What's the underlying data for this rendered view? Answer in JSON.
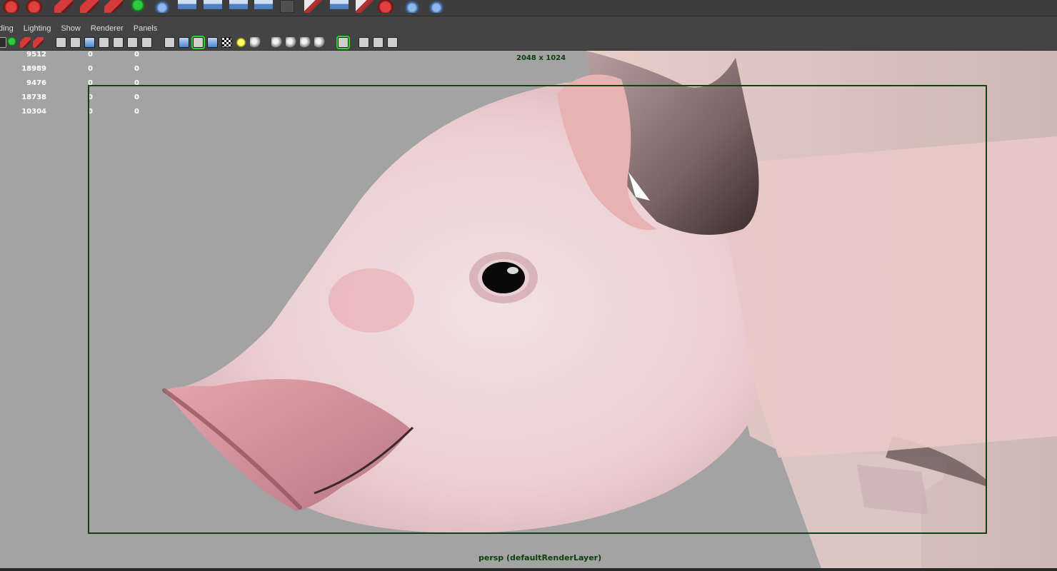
{
  "shelf": {
    "icons": [
      "red-curve-icon",
      "red-paint-icon",
      "red-stroke-icon",
      "red-brush-icon",
      "red-arrow-icon",
      "green-vertex-icon",
      "sphere-cut-icon",
      "cluster-icon",
      "cluster-icon-2",
      "cluster-icon-3",
      "cluster-icon-4",
      "node-graph-icon",
      "cube-copy-icon",
      "cube-copy-icon-2",
      "cube-copy-icon-3",
      "no-render-icon",
      "joint-tool-icon",
      "ik-tool-icon"
    ]
  },
  "panel_menu": {
    "items": [
      "ding",
      "Lighting",
      "Show",
      "Renderer",
      "Panels"
    ]
  },
  "panel_toolbar": {
    "icons": [
      "camera-attribute-icon",
      "image-plane-icon",
      "bookmark-icon",
      "grid-icon",
      "film-gate-icon",
      "resolution-gate-icon",
      "gate-mask-icon",
      "field-chart-icon",
      "safe-action-icon",
      "safe-title-icon",
      "wireframe-icon",
      "smooth-shade-icon",
      "wireframe-on-shaded-icon",
      "flat-shade-icon",
      "bounding-box-icon",
      "textured-icon",
      "use-all-lights-icon",
      "shadows-icon",
      "ambient-occlusion-icon",
      "motion-blur-icon",
      "anti-aliasing-icon",
      "depth-of-field-icon",
      "isolate-select-icon",
      "xray-icon",
      "xray-joints-icon",
      "xray-components-icon"
    ]
  },
  "hud": {
    "rows": [
      [
        "9512",
        "0",
        "0"
      ],
      [
        "18989",
        "0",
        "0"
      ],
      [
        "9476",
        "0",
        "0"
      ],
      [
        "18738",
        "0",
        "0"
      ],
      [
        "10304",
        "0",
        "0"
      ]
    ]
  },
  "viewport": {
    "resolution_label": "2048 x 1024",
    "camera_label": "persp (defaultRenderLayer)",
    "gate_color": "#124212",
    "background_color": "#a3a3a3"
  }
}
